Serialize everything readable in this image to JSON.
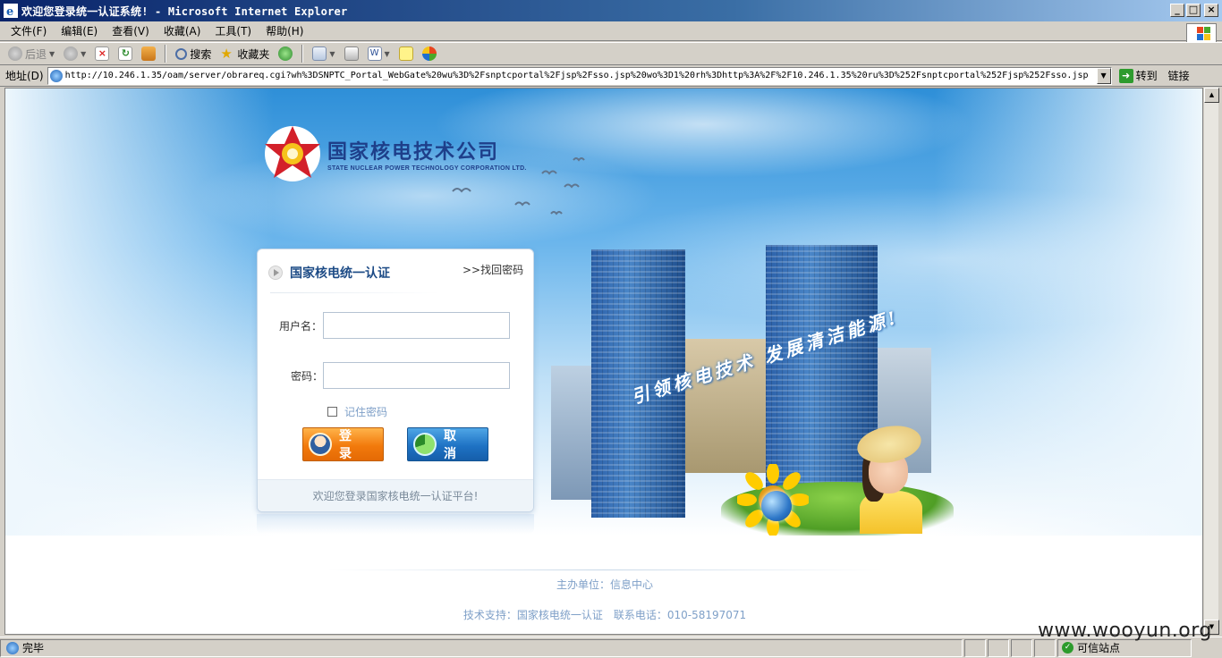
{
  "window": {
    "title": "欢迎您登录统一认证系统! - Microsoft Internet Explorer",
    "buttons": [
      "_",
      "□",
      "×"
    ]
  },
  "menubar": {
    "items": [
      "文件(F)",
      "编辑(E)",
      "查看(V)",
      "收藏(A)",
      "工具(T)",
      "帮助(H)"
    ]
  },
  "toolbar": {
    "back": "后退",
    "search": "搜索",
    "favorites": "收藏夹"
  },
  "address": {
    "label": "地址(D)",
    "url": "http://10.246.1.35/oam/server/obrareq.cgi?wh%3DSNPTC_Portal_WebGate%20wu%3D%2Fsnptcportal%2Fjsp%2Fsso.jsp%20wo%3D1%20rh%3Dhttp%3A%2F%2F10.246.1.35%20ru%3D%252Fsnptcportal%252Fjsp%252Fsso.jsp",
    "go": "转到",
    "links": "链接"
  },
  "page": {
    "logo": {
      "cn": "国家核电技术公司",
      "en": "STATE NUCLEAR POWER TECHNOLOGY CORPORATION LTD."
    },
    "slogan": "引领核电技术 发展清洁能源!",
    "login": {
      "title": "国家核电统一认证",
      "forgot": ">>找回密码",
      "username_label": "用户名：",
      "username_value": "",
      "password_label": "密码：",
      "password_value": "",
      "remember": "记住密码",
      "remember_checked": false,
      "login_button": "登 录",
      "cancel_button": "取 消",
      "welcome": "欢迎您登录国家核电统一认证平台!"
    },
    "footer": {
      "host": "主办单位：信息中心",
      "support": "技术支持：国家核电统一认证　联系电话：010-58197071"
    }
  },
  "statusbar": {
    "status": "完毕",
    "zone": "可信站点"
  },
  "watermark": "www.wooyun.org",
  "colors": {
    "titlebar": "#0a246a",
    "login_button": "#f27a0c",
    "cancel_button": "#1e72c4",
    "login_title": "#1d4b86",
    "footer_text": "#7fa0c8"
  }
}
